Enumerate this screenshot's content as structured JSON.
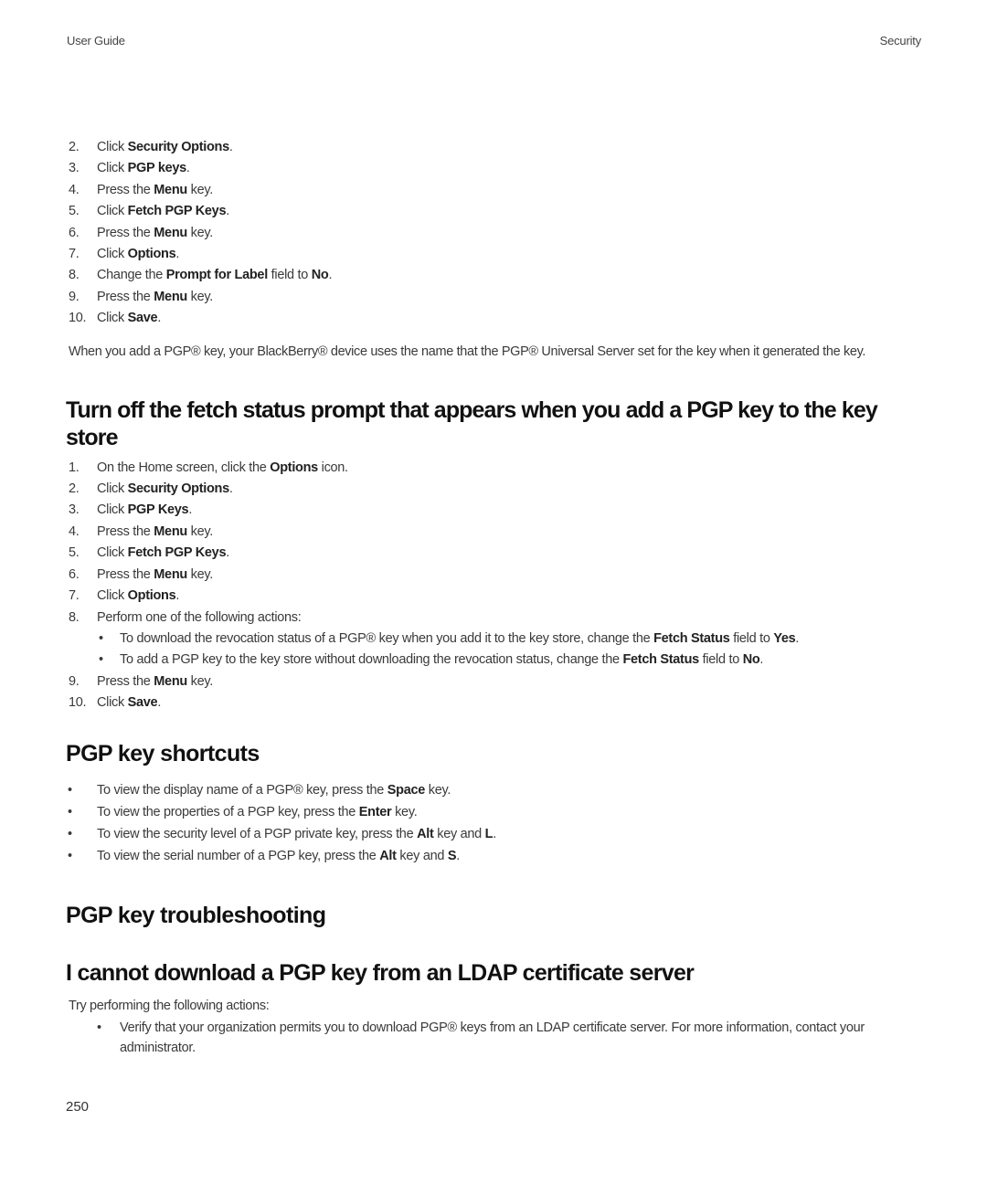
{
  "header": {
    "left": "User Guide",
    "right": "Security"
  },
  "section1": {
    "steps": [
      {
        "num": "2.",
        "pre": "Click ",
        "bold": "Security Options",
        "post": "."
      },
      {
        "num": "3.",
        "pre": "Click ",
        "bold": "PGP keys",
        "post": "."
      },
      {
        "num": "4.",
        "pre": "Press the ",
        "bold": "Menu",
        "post": " key."
      },
      {
        "num": "5.",
        "pre": "Click ",
        "bold": "Fetch PGP Keys",
        "post": "."
      },
      {
        "num": "6.",
        "pre": "Press the ",
        "bold": "Menu",
        "post": " key."
      },
      {
        "num": "7.",
        "pre": "Click ",
        "bold": "Options",
        "post": "."
      },
      {
        "num": "8.",
        "pre": "Change the ",
        "bold": "Prompt for Label",
        "mid": " field to ",
        "bold2": "No",
        "post": "."
      },
      {
        "num": "9.",
        "pre": "Press the ",
        "bold": "Menu",
        "post": " key."
      },
      {
        "num": "10.",
        "pre": "Click ",
        "bold": "Save",
        "post": "."
      }
    ],
    "note": "When you add a PGP® key, your BlackBerry® device uses the name that the PGP® Universal Server set for the key when it generated the key."
  },
  "section2": {
    "title": "Turn off the fetch status prompt that appears when you add a PGP key to the key store",
    "steps": [
      {
        "num": "1.",
        "pre": "On the Home screen, click the ",
        "bold": "Options",
        "post": " icon."
      },
      {
        "num": "2.",
        "pre": "Click ",
        "bold": "Security Options",
        "post": "."
      },
      {
        "num": "3.",
        "pre": "Click ",
        "bold": "PGP Keys",
        "post": "."
      },
      {
        "num": "4.",
        "pre": "Press the ",
        "bold": "Menu",
        "post": " key."
      },
      {
        "num": "5.",
        "pre": "Click ",
        "bold": "Fetch PGP Keys",
        "post": "."
      },
      {
        "num": "6.",
        "pre": "Press the ",
        "bold": "Menu",
        "post": " key."
      },
      {
        "num": "7.",
        "pre": "Click ",
        "bold": "Options",
        "post": "."
      },
      {
        "num": "8.",
        "pre": "Perform one of the following actions:",
        "bold": "",
        "post": ""
      }
    ],
    "sub_actions": [
      {
        "pre": "To download the revocation status of a PGP® key when you add it to the key store, change the ",
        "bold": "Fetch Status",
        "mid": " field to ",
        "bold2": "Yes",
        "post": "."
      },
      {
        "pre": "To add a PGP key to the key store without downloading the revocation status, change the ",
        "bold": "Fetch Status",
        "mid": " field to ",
        "bold2": "No",
        "post": "."
      }
    ],
    "steps_after": [
      {
        "num": "9.",
        "pre": "Press the ",
        "bold": "Menu",
        "post": " key."
      },
      {
        "num": "10.",
        "pre": "Click ",
        "bold": "Save",
        "post": "."
      }
    ]
  },
  "section3": {
    "title": "PGP key shortcuts",
    "bullets": [
      {
        "pre": "To view the display name of a PGP® key, press the ",
        "bold": "Space",
        "post": " key."
      },
      {
        "pre": "To view the properties of a PGP key, press the ",
        "bold": "Enter",
        "post": " key."
      },
      {
        "pre": "To view the security level of a PGP private key, press the ",
        "bold": "Alt",
        "mid": " key and ",
        "bold2": "L",
        "post": "."
      },
      {
        "pre": "To view the serial number of a PGP key, press the ",
        "bold": "Alt",
        "mid": " key and ",
        "bold2": "S",
        "post": "."
      }
    ]
  },
  "section4": {
    "title": "PGP key troubleshooting"
  },
  "section5": {
    "title": "I cannot download a PGP key from an LDAP certificate server",
    "intro": "Try performing the following actions:",
    "bullets": [
      {
        "text": "Verify that your organization permits you to download PGP® keys from an LDAP certificate server. For more information, contact your administrator."
      }
    ]
  },
  "bullet_glyph": "•",
  "page_number": "250"
}
